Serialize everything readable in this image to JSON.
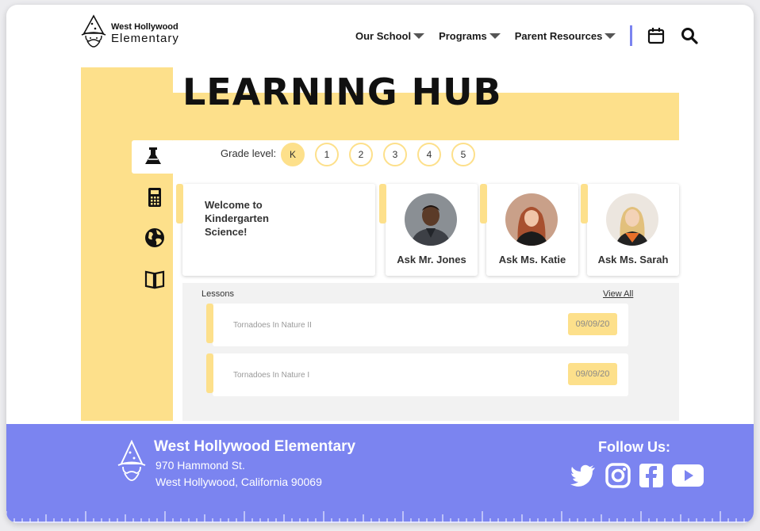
{
  "header": {
    "logo_line1": "West Hollywood",
    "logo_line2": "Elementary",
    "nav": [
      "Our School",
      "Programs",
      "Parent Resources"
    ]
  },
  "hub": {
    "title": "LEARNING HUB"
  },
  "subjects": [
    "flask-icon",
    "calculator-icon",
    "globe-icon",
    "book-icon"
  ],
  "grade": {
    "label": "Grade level:",
    "levels": [
      "K",
      "1",
      "2",
      "3",
      "4",
      "5"
    ],
    "selected": "K"
  },
  "welcome": {
    "text": "Welcome to Kindergarten Science!"
  },
  "teachers": [
    {
      "name": "Ask Mr. Jones"
    },
    {
      "name": "Ask Ms. Katie"
    },
    {
      "name": "Ask Ms. Sarah"
    }
  ],
  "lessons": {
    "title": "Lessons",
    "view_all": "View All",
    "items": [
      {
        "name": "Tornadoes In Nature II",
        "date": "09/09/20"
      },
      {
        "name": "Tornadoes In Nature I",
        "date": "09/09/20"
      }
    ]
  },
  "footer": {
    "school": "West Hollywood Elementary",
    "address1": "970 Hammond St.",
    "address2": "West Hollywood, California 90069",
    "follow": "Follow Us:",
    "social": [
      "twitter-icon",
      "instagram-icon",
      "facebook-icon",
      "youtube-icon"
    ]
  },
  "colors": {
    "accent_yellow": "#fde08b",
    "footer_blue": "#7b84f0"
  }
}
